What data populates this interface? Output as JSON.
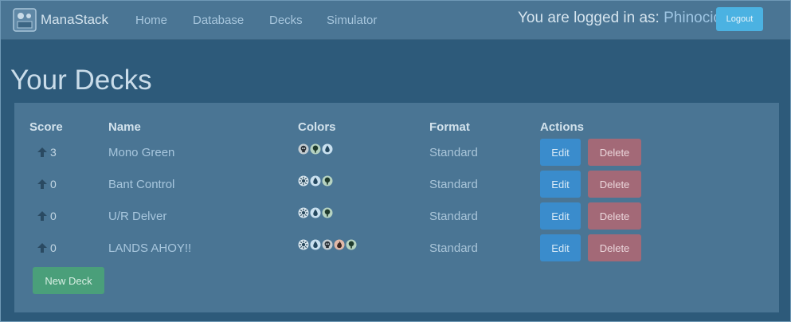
{
  "navbar": {
    "brand": "ManaStack",
    "links": [
      "Home",
      "Database",
      "Decks",
      "Simulator"
    ],
    "login_prefix": "You are logged in as:",
    "username": "Phinocio",
    "logout_label": "Logout"
  },
  "page": {
    "title": "Your Decks"
  },
  "table": {
    "headers": {
      "score": "Score",
      "name": "Name",
      "colors": "Colors",
      "format": "Format",
      "actions": "Actions"
    },
    "rows": [
      {
        "score": "3",
        "name": "Mono Green",
        "colors": [
          "black-skull-icon",
          "green-tree-icon",
          "blue-drop-icon"
        ],
        "format": "Standard",
        "edit": "Edit",
        "delete": "Delete"
      },
      {
        "score": "0",
        "name": "Bant Control",
        "colors": [
          "white-sun-icon",
          "blue-drop-icon",
          "green-tree-icon"
        ],
        "format": "Standard",
        "edit": "Edit",
        "delete": "Delete"
      },
      {
        "score": "0",
        "name": "U/R Delver",
        "colors": [
          "white-sun-icon",
          "blue-drop-icon",
          "green-tree-icon"
        ],
        "format": "Standard",
        "edit": "Edit",
        "delete": "Delete"
      },
      {
        "score": "0",
        "name": "LANDS AHOY!!",
        "colors": [
          "white-sun-icon",
          "blue-drop-icon",
          "black-skull-icon",
          "red-fire-icon",
          "green-tree-icon"
        ],
        "format": "Standard",
        "edit": "Edit",
        "delete": "Delete"
      }
    ]
  },
  "new_deck_label": "New Deck",
  "colors": {
    "background": "#2d5a7a",
    "navbar": "#4a7594",
    "edit_button": "#3a8ccc",
    "delete_button": "#a36977",
    "new_button": "#4a9f7a",
    "logout_button": "#4bb2e2"
  }
}
